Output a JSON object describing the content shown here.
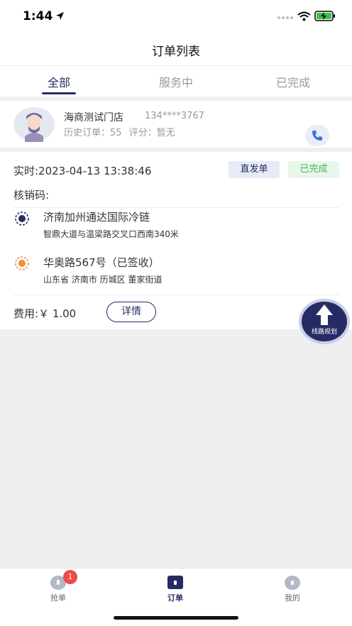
{
  "status_bar": {
    "time": "1:44"
  },
  "nav": {
    "title": "订单列表"
  },
  "tabs": [
    {
      "label": "全部",
      "active": true
    },
    {
      "label": "服务中",
      "active": false
    },
    {
      "label": "已完成",
      "active": false
    }
  ],
  "store": {
    "name": "海商测试门店",
    "phone": "134****3767",
    "history_orders": "历史订单：55",
    "rating": "评分：暂无"
  },
  "order": {
    "time": "实时:2023-04-13 13:38:46",
    "type_badge": "直发单",
    "status_badge": "已完成",
    "verify_code_label": "核销码:",
    "pickup": {
      "name": "济南加州通达国际冷链",
      "address": "智鼎大道与温梁路交叉口西南340米"
    },
    "dropoff": {
      "name": "华奥路567号（已签收）",
      "address": "山东省 济南市 历城区 董家街道"
    },
    "fee": "费用:￥ 1.00",
    "detail_button": "详情"
  },
  "route_button": {
    "label": "线路规划"
  },
  "tabbar": {
    "items": [
      {
        "label": "抢单",
        "active": false,
        "badge": "1"
      },
      {
        "label": "订单",
        "active": true
      },
      {
        "label": "我的",
        "active": false
      }
    ]
  },
  "colors": {
    "accent": "#262c63",
    "completed": "#46b35c",
    "badge_red": "#ef4a4a",
    "dropoff_orange": "#f0903a"
  }
}
